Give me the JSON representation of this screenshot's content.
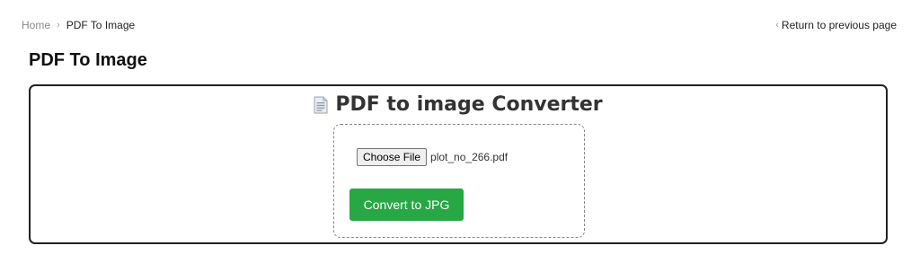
{
  "breadcrumb": {
    "home": "Home",
    "separator": "›",
    "current": "PDF To Image"
  },
  "return_link": {
    "chevron": "‹",
    "label": "Return to previous page"
  },
  "page_title": "PDF To Image",
  "converter": {
    "icon": "document-icon",
    "title": "PDF to image Converter",
    "file_input": {
      "button_label": "Choose File",
      "file_name": "plot_no_266.pdf"
    },
    "convert_button_label": "Convert to JPG"
  },
  "colors": {
    "accent_green": "#28a745",
    "border_dark": "#222222"
  }
}
